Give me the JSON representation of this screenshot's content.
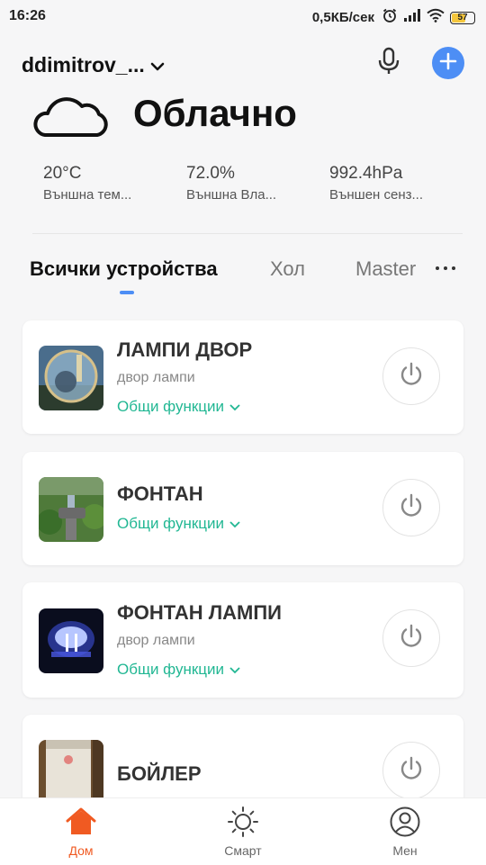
{
  "status_bar": {
    "time": "16:26",
    "net_speed": "0,5КБ/сек",
    "battery": "57",
    "battery_level": 0.57
  },
  "header": {
    "home_name": "ddimitrov_...",
    "icons": [
      "mic-icon",
      "add-icon"
    ]
  },
  "weather": {
    "condition": "Облачно",
    "icon": "cloud-icon",
    "stats": [
      {
        "value": "20°C",
        "label": "Външна тем..."
      },
      {
        "value": "72.0%",
        "label": "Външна Вла..."
      },
      {
        "value": "992.4hPa",
        "label": "Външен сенз..."
      }
    ]
  },
  "tabs": [
    {
      "label": "Всички устройства",
      "active": true
    },
    {
      "label": "Хол",
      "active": false
    },
    {
      "label": "Master",
      "active": false
    }
  ],
  "devices": [
    {
      "name": "ЛАМПИ ДВОР",
      "room": "двор лампи",
      "func": "Общи функции"
    },
    {
      "name": "ФОНТАН",
      "room": "",
      "func": "Общи функции"
    },
    {
      "name": "ФОНТАН ЛАМПИ",
      "room": "двор лампи",
      "func": "Общи функции"
    },
    {
      "name": "БОЙЛЕР",
      "room": "",
      "func": ""
    }
  ],
  "nav": [
    {
      "label": "Дом",
      "active": true
    },
    {
      "label": "Смарт",
      "active": false
    },
    {
      "label": "Мен",
      "active": false
    }
  ],
  "colors": {
    "accent_blue": "#4d8ef5",
    "function_green": "#21b793",
    "nav_active": "#f05a22"
  }
}
